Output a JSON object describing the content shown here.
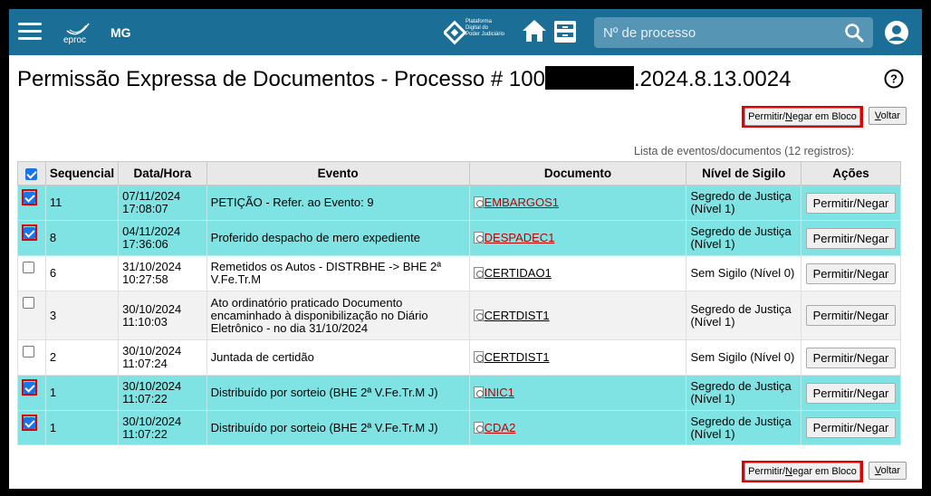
{
  "header": {
    "logo_text": "eproc",
    "state": "MG",
    "pdpj_lines": [
      "Plataforma",
      "Digital do",
      "Poder Judiciário"
    ],
    "search_placeholder": "Nº de processo"
  },
  "page": {
    "title_prefix": "Permissão Expressa de Documentos - Processo # 100",
    "title_suffix": ".2024.8.13.0024",
    "bloco_prefix": "Permitir/",
    "bloco_underline": "N",
    "bloco_suffix": "egar em Bloco",
    "voltar_underline": "V",
    "voltar_suffix": "oltar",
    "caption": "Lista de eventos/documentos (12 registros):"
  },
  "table": {
    "columns": [
      "Sequencial",
      "Data/Hora",
      "Evento",
      "Documento",
      "Nível de Sigilo",
      "Ações"
    ],
    "rows": [
      {
        "checked": true,
        "seq": "11",
        "date": "07/11/2024",
        "time": "17:08:07",
        "event": "PETIÇÃO - Refer. ao Evento: 9",
        "doc": "EMBARGOS1",
        "sigilo": "Segredo de Justiça (Nível 1)",
        "action": "Permitir/Negar"
      },
      {
        "checked": true,
        "seq": "8",
        "date": "04/11/2024",
        "time": "17:36:06",
        "event": "Proferido despacho de mero expediente",
        "doc": "DESPADEC1",
        "sigilo": "Segredo de Justiça (Nível 1)",
        "action": "Permitir/Negar"
      },
      {
        "checked": false,
        "seq": "6",
        "date": "31/10/2024",
        "time": "10:27:58",
        "event": "Remetidos os Autos - DISTRBHE -> BHE 2ª V.Fe.Tr.M",
        "doc": "CERTIDAO1",
        "sigilo": "Sem Sigilo (Nível 0)",
        "action": "Permitir/Negar"
      },
      {
        "checked": false,
        "seq": "3",
        "date": "30/10/2024",
        "time": "11:10:03",
        "event": "Ato ordinatório praticado Documento encaminhado à disponibilização no Diário Eletrônico - no dia 31/10/2024",
        "doc": "CERTDIST1",
        "sigilo": "Segredo de Justiça (Nível 1)",
        "action": "Permitir/Negar"
      },
      {
        "checked": false,
        "seq": "2",
        "date": "30/10/2024",
        "time": "11:07:24",
        "event": "Juntada de certidão",
        "doc": "CERTDIST1",
        "sigilo": "Sem Sigilo (Nível 0)",
        "action": "Permitir/Negar"
      },
      {
        "checked": true,
        "seq": "1",
        "date": "30/10/2024",
        "time": "11:07:22",
        "event": "Distribuído por sorteio (BHE 2ª V.Fe.Tr.M J)",
        "doc": "INIC1",
        "sigilo": "Segredo de Justiça (Nível 1)",
        "action": "Permitir/Negar"
      },
      {
        "checked": true,
        "seq": "1",
        "date": "30/10/2024",
        "time": "11:07:22",
        "event": "Distribuído por sorteio (BHE 2ª V.Fe.Tr.M J)",
        "doc": "CDA2",
        "sigilo": "Segredo de Justiça (Nível 1)",
        "action": "Permitir/Negar"
      }
    ]
  },
  "colors": {
    "topbar": "#1b6f97",
    "selected_row": "#7fe3e3",
    "highlight": "#e00000"
  },
  "icons": [
    "hamburger-icon",
    "eproc-logo",
    "pdpj-logo",
    "home-icon",
    "inbox-icon",
    "search-icon",
    "user-icon",
    "help-icon",
    "document-icon"
  ]
}
